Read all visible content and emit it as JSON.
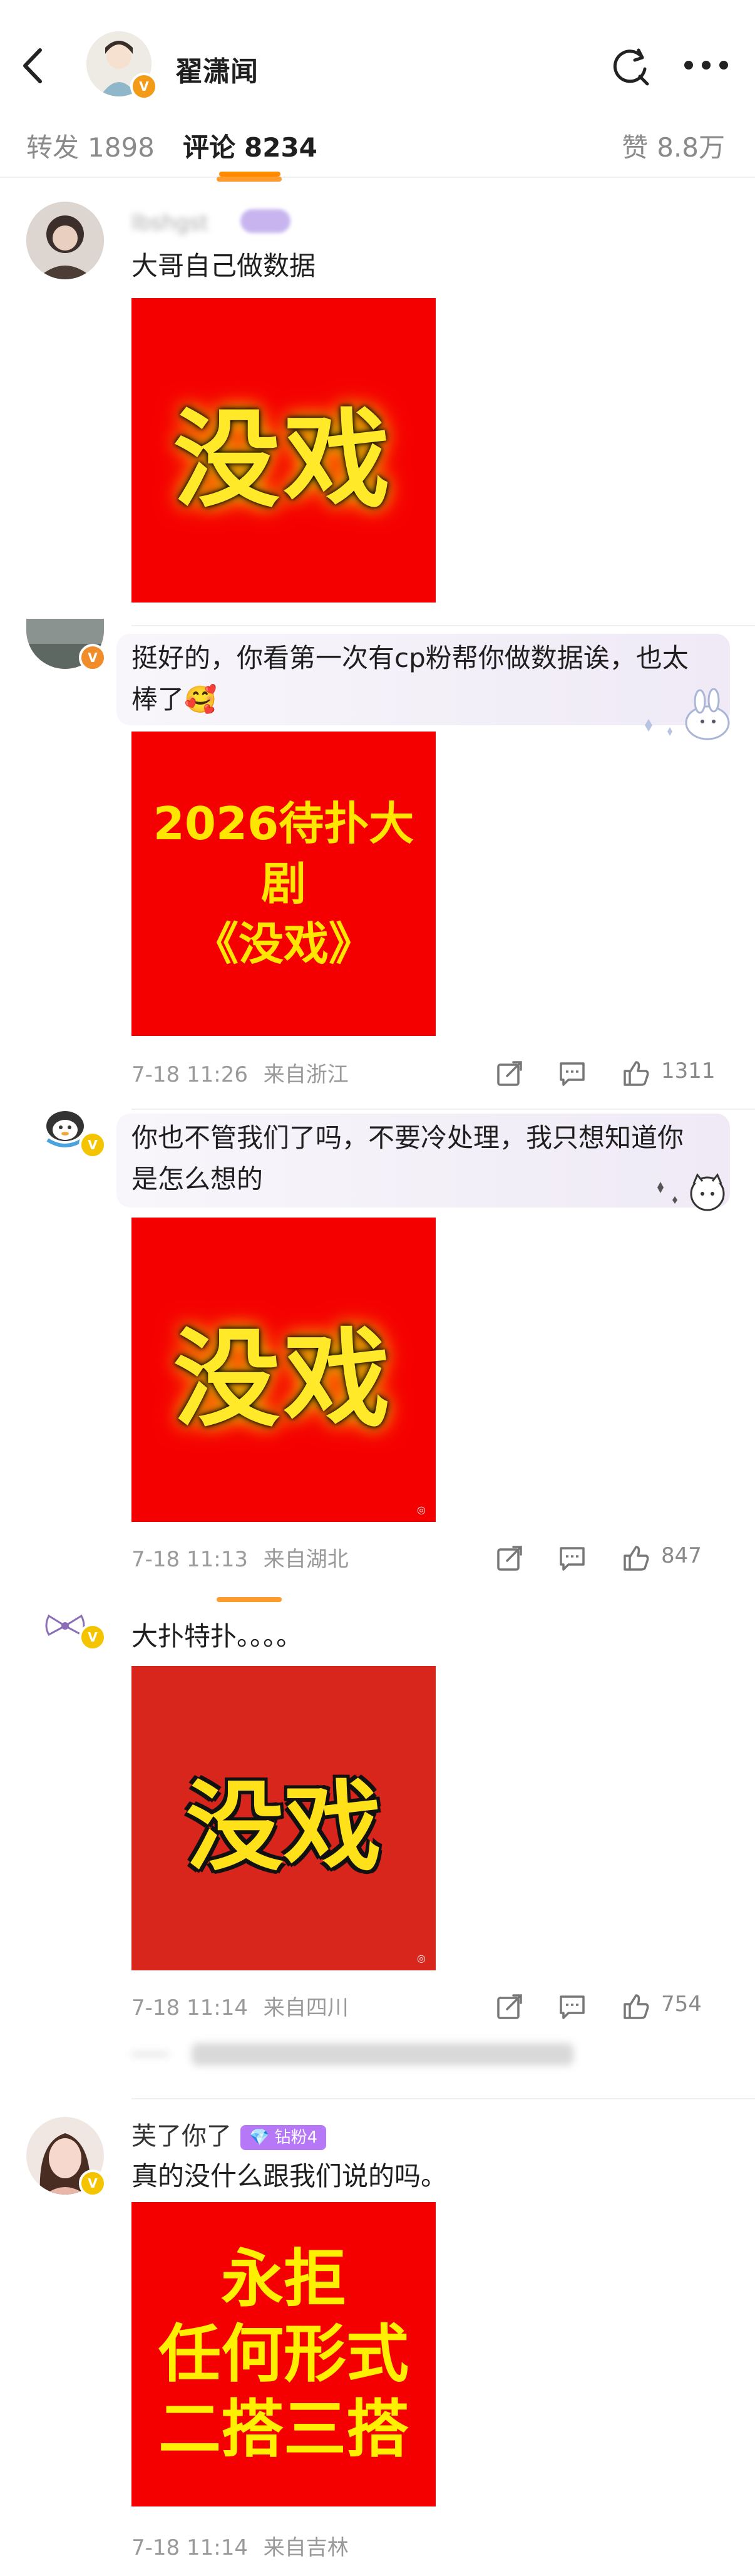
{
  "header": {
    "name": "翟潇闻",
    "verified_color": "#f39b16"
  },
  "tabs": {
    "repost_label": "转发",
    "repost_count": "1898",
    "comment_label": "评论",
    "comment_count": "8234",
    "like_label": "赞",
    "like_count": "8.8万",
    "accent": "#ff8a00"
  },
  "comments": [
    {
      "text": "大哥自己做数据",
      "image_text": "没戏"
    },
    {
      "text": "挺好的，你看第一次有cp粉帮你做数据诶，也太棒了🥰",
      "image_lines": [
        "2026待扑大剧",
        "《没戏》"
      ],
      "time": "7-18 11:26",
      "location": "来自浙江",
      "likes": "1311"
    },
    {
      "text": "你也不管我们了吗，不要冷处理，我只想知道你是怎么想的",
      "image_text": "没戏",
      "time": "7-18 11:13",
      "location": "来自湖北",
      "likes": "847"
    },
    {
      "text": "大扑特扑。。。。",
      "image_text": "没戏",
      "time": "7-18 11:14",
      "location": "来自四川",
      "likes": "754"
    },
    {
      "name": "芙了你了",
      "fan_badge": "钻粉4",
      "text": "真的没什么跟我们说的吗。",
      "image_lines": [
        "永拒",
        "任何形式",
        "二搭三搭"
      ],
      "time": "7-18 11:14",
      "location": "来自吉林"
    }
  ],
  "colors": {
    "image_red": "#f50000",
    "image_red_dark": "#d9261c",
    "image_yellow": "#ffe928"
  }
}
